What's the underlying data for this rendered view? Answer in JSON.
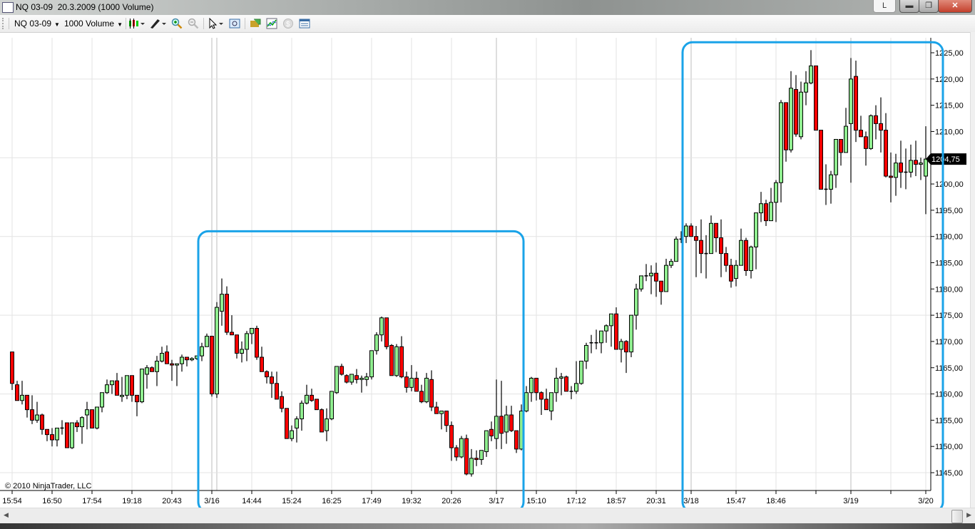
{
  "window": {
    "title": "NQ 03-09  20.3.2009 (1000 Volume)",
    "layout_button": "L",
    "minimize_icon": "minimize-icon",
    "maximize_icon": "restore-icon",
    "close_icon": "close-icon"
  },
  "toolbar": {
    "instrument": "NQ 03-09",
    "period": "1000 Volume",
    "icons": [
      "candlestick-style-icon",
      "drawing-pencil-icon",
      "zoom-in-icon",
      "zoom-out-icon",
      "pointer-icon",
      "data-box-icon",
      "strategies-icon",
      "indicators-icon",
      "currency-icon",
      "properties-icon"
    ]
  },
  "colors": {
    "up_candle": "#90ee90",
    "down_candle": "#ff0000",
    "highlight_box": "#1aa3e8",
    "grid": "#e3e3e3",
    "session_line": "#bdbdbd"
  },
  "chart": {
    "copyright": "© 2010 NinjaTrader, LLC",
    "last_price_label": "1204,75"
  },
  "chart_data": {
    "type": "candlestick",
    "instrument": "NQ 03-09",
    "bar_type": "1000 Volume",
    "ylim": [
      1143,
      1228
    ],
    "y_ticks": [
      "1225,00",
      "1220,00",
      "1215,00",
      "1210,00",
      "1205,00",
      "1200,00",
      "1195,00",
      "1190,00",
      "1185,00",
      "1180,00",
      "1175,00",
      "1170,00",
      "1165,00",
      "1160,00",
      "1155,00",
      "1150,00",
      "1145,00"
    ],
    "y_tick_values": [
      1225,
      1220,
      1215,
      1210,
      1205,
      1200,
      1195,
      1190,
      1185,
      1180,
      1175,
      1170,
      1165,
      1160,
      1155,
      1150,
      1145
    ],
    "x_ticks": [
      {
        "label": "15:54",
        "bar": 0
      },
      {
        "label": "16:50",
        "bar": 8
      },
      {
        "label": "17:54",
        "bar": 16
      },
      {
        "label": "19:18",
        "bar": 24
      },
      {
        "label": "20:43",
        "bar": 32
      },
      {
        "label": "3/16",
        "bar": 40
      },
      {
        "label": "14:44",
        "bar": 48
      },
      {
        "label": "15:24",
        "bar": 56
      },
      {
        "label": "16:25",
        "bar": 64
      },
      {
        "label": "17:49",
        "bar": 72
      },
      {
        "label": "19:32",
        "bar": 80
      },
      {
        "label": "20:26",
        "bar": 88
      },
      {
        "label": "3/17",
        "bar": 97
      },
      {
        "label": "15:10",
        "bar": 105
      },
      {
        "label": "17:12",
        "bar": 113
      },
      {
        "label": "18:57",
        "bar": 121
      },
      {
        "label": "20:31",
        "bar": 129
      },
      {
        "label": "3/18",
        "bar": 136
      },
      {
        "label": "15:47",
        "bar": 145
      },
      {
        "label": "18:46",
        "bar": 153
      },
      {
        "label": "",
        "bar": 161
      },
      {
        "label": "3/19",
        "bar": 168
      },
      {
        "label": "",
        "bar": 176
      },
      {
        "label": "3/20",
        "bar": 183
      }
    ],
    "session_breaks": [
      40,
      97,
      136,
      168
    ],
    "last_price": 1204.75,
    "ohlc": [
      [
        1168,
        1168,
        1160.75,
        1162
      ],
      [
        1161.75,
        1162.5,
        1158.75,
        1158.75
      ],
      [
        1158.75,
        1162.5,
        1158,
        1159.75
      ],
      [
        1159.75,
        1159.75,
        1155.5,
        1157
      ],
      [
        1157,
        1159.75,
        1154.25,
        1155
      ],
      [
        1155,
        1158.5,
        1154.5,
        1156
      ],
      [
        1156,
        1156.25,
        1152.25,
        1153.25
      ],
      [
        1153.25,
        1153.25,
        1151,
        1152.25
      ],
      [
        1152.25,
        1153.5,
        1150,
        1151.25
      ],
      [
        1151.25,
        1153.5,
        1150,
        1153.5
      ],
      [
        1153.5,
        1155,
        1152.25,
        1153.5
      ],
      [
        1154.5,
        1154.5,
        1149.75,
        1149.75
      ],
      [
        1149.75,
        1154.5,
        1149.5,
        1154.5
      ],
      [
        1154.5,
        1155,
        1152.75,
        1153.75
      ],
      [
        1153.75,
        1155.75,
        1150.5,
        1155.5
      ],
      [
        1156,
        1158.5,
        1153.25,
        1157
      ],
      [
        1157,
        1157,
        1153.5,
        1153.5
      ],
      [
        1153.5,
        1157.5,
        1153.25,
        1157.5
      ],
      [
        1157.5,
        1160.25,
        1156.5,
        1160.25
      ],
      [
        1160.25,
        1162.75,
        1160,
        1161.75
      ],
      [
        1161.75,
        1162.5,
        1160,
        1162.5
      ],
      [
        1162.5,
        1164,
        1159.75,
        1159.75
      ],
      [
        1159.5,
        1163.25,
        1158.5,
        1159.75
      ],
      [
        1159.75,
        1163.5,
        1159,
        1163.5
      ],
      [
        1163.5,
        1163.5,
        1158.5,
        1159.75
      ],
      [
        1159.75,
        1159.75,
        1155.75,
        1158.5
      ],
      [
        1158.5,
        1164.75,
        1158.25,
        1164.75
      ],
      [
        1163.75,
        1165.5,
        1161,
        1165
      ],
      [
        1165,
        1165.25,
        1164.25,
        1164.25
      ],
      [
        1164.25,
        1167.25,
        1161.5,
        1166.25
      ],
      [
        1166.25,
        1169,
        1166,
        1167.75
      ],
      [
        1168,
        1169.25,
        1165.75,
        1165.75
      ],
      [
        1165.75,
        1166.5,
        1162.5,
        1165.5
      ],
      [
        1165.5,
        1165.75,
        1161.5,
        1165.75
      ],
      [
        1165.75,
        1167.5,
        1164.25,
        1167
      ],
      [
        1167,
        1167,
        1165.25,
        1166.5
      ],
      [
        1166.5,
        1167,
        1166.25,
        1166.75
      ],
      [
        1166.75,
        1167.25,
        1166.5,
        1167.25
      ],
      [
        1167.25,
        1169.75,
        1166.25,
        1169
      ],
      [
        1169,
        1171.5,
        1169,
        1171
      ],
      [
        1171,
        1171,
        1159.5,
        1160
      ],
      [
        1160,
        1177.5,
        1159.25,
        1176.5
      ],
      [
        1175.75,
        1182,
        1173,
        1179
      ],
      [
        1179,
        1180.5,
        1171.25,
        1171.75
      ],
      [
        1171.75,
        1175,
        1171.25,
        1171.25
      ],
      [
        1171.25,
        1171.25,
        1166.75,
        1167.75
      ],
      [
        1167.75,
        1170,
        1166,
        1168.5
      ],
      [
        1168.5,
        1172,
        1166.25,
        1171.5
      ],
      [
        1171.5,
        1172.5,
        1169.5,
        1172.5
      ],
      [
        1172.5,
        1173,
        1166.5,
        1167
      ],
      [
        1167,
        1169,
        1164.25,
        1164.25
      ],
      [
        1164.25,
        1164.5,
        1162,
        1163.25
      ],
      [
        1163.25,
        1164.25,
        1159.25,
        1162
      ],
      [
        1162,
        1164.25,
        1159,
        1159
      ],
      [
        1159.5,
        1160.5,
        1156.5,
        1157.25
      ],
      [
        1157.25,
        1157.25,
        1151.5,
        1151.5
      ],
      [
        1151.5,
        1154,
        1151,
        1153
      ],
      [
        1153.5,
        1155.75,
        1150.75,
        1155.25
      ],
      [
        1155.25,
        1158.75,
        1153,
        1158.25
      ],
      [
        1158.25,
        1161.75,
        1158,
        1159.75
      ],
      [
        1159.75,
        1161,
        1158.5,
        1158.75
      ],
      [
        1159,
        1159,
        1157,
        1157
      ],
      [
        1157,
        1157.25,
        1152.75,
        1152.75
      ],
      [
        1153,
        1157.25,
        1151,
        1155.25
      ],
      [
        1155.25,
        1160.5,
        1155,
        1160.5
      ],
      [
        1160.25,
        1165.25,
        1160,
        1165.25
      ],
      [
        1165.25,
        1165.75,
        1163.5,
        1163.75
      ],
      [
        1163.5,
        1163.75,
        1162,
        1162.25
      ],
      [
        1162.25,
        1163.75,
        1161.75,
        1163.75
      ],
      [
        1163.5,
        1164.75,
        1162,
        1162.75
      ],
      [
        1162.75,
        1163.5,
        1160.25,
        1163
      ],
      [
        1162.75,
        1164,
        1161.5,
        1163.25
      ],
      [
        1163.25,
        1168.25,
        1162.75,
        1168.25
      ],
      [
        1168.25,
        1171.75,
        1167.5,
        1171.25
      ],
      [
        1171.25,
        1174.75,
        1170,
        1174.5
      ],
      [
        1174.5,
        1174.5,
        1168.5,
        1169
      ],
      [
        1169.25,
        1169.5,
        1163.5,
        1163.5
      ],
      [
        1163.5,
        1169.5,
        1163.25,
        1169
      ],
      [
        1169,
        1171,
        1163,
        1163.25
      ],
      [
        1163.25,
        1164.25,
        1160.25,
        1161.25
      ],
      [
        1161.25,
        1165.5,
        1160.5,
        1163
      ],
      [
        1163,
        1164.25,
        1160.5,
        1160.5
      ],
      [
        1160.5,
        1161.75,
        1158.25,
        1158.5
      ],
      [
        1158.5,
        1164,
        1158.25,
        1163
      ],
      [
        1162.75,
        1164.5,
        1156.75,
        1157.5
      ],
      [
        1157.5,
        1158.5,
        1156.25,
        1156.25
      ],
      [
        1156.25,
        1156.75,
        1153.25,
        1156.75
      ],
      [
        1156.75,
        1156.75,
        1152.75,
        1154
      ],
      [
        1154,
        1154.75,
        1147.25,
        1149.75
      ],
      [
        1149.75,
        1150.25,
        1147.25,
        1148
      ],
      [
        1148,
        1152,
        1147.75,
        1151.5
      ],
      [
        1151.5,
        1152.25,
        1144.5,
        1144.75
      ],
      [
        1144.75,
        1149.5,
        1144.25,
        1147.75
      ],
      [
        1147.75,
        1149.25,
        1146.25,
        1147.5
      ],
      [
        1147.5,
        1149.25,
        1146.5,
        1149.25
      ],
      [
        1149,
        1153,
        1148,
        1153
      ],
      [
        1153.25,
        1154.75,
        1151,
        1152
      ],
      [
        1151.5,
        1162.75,
        1149.5,
        1155.75
      ],
      [
        1155.75,
        1162.5,
        1149.5,
        1152.5
      ],
      [
        1152.75,
        1157.75,
        1150.5,
        1156
      ],
      [
        1156,
        1157.75,
        1152.75,
        1153
      ],
      [
        1153,
        1153,
        1148.75,
        1149.5
      ],
      [
        1149.5,
        1158,
        1149.25,
        1156.75
      ],
      [
        1156.75,
        1161.5,
        1156.5,
        1160.25
      ],
      [
        1160.25,
        1163.25,
        1158.5,
        1163
      ],
      [
        1163,
        1163,
        1158.75,
        1160.25
      ],
      [
        1160.25,
        1160.5,
        1156,
        1159
      ],
      [
        1159,
        1161,
        1157,
        1157
      ],
      [
        1156.75,
        1160.25,
        1155,
        1160.25
      ],
      [
        1160.25,
        1165,
        1158.5,
        1163
      ],
      [
        1163,
        1164,
        1159.75,
        1163.25
      ],
      [
        1163.25,
        1163.5,
        1160.5,
        1160.5
      ],
      [
        1160.5,
        1161.5,
        1159,
        1160.5
      ],
      [
        1160.5,
        1166.25,
        1160,
        1162
      ],
      [
        1162,
        1166.25,
        1161.75,
        1166.25
      ],
      [
        1166.25,
        1169.75,
        1164.75,
        1169.25
      ],
      [
        1169.75,
        1171.25,
        1167.75,
        1169.75
      ],
      [
        1169.75,
        1172.25,
        1168.5,
        1169.75
      ],
      [
        1169.75,
        1172,
        1167.75,
        1172
      ],
      [
        1172,
        1173.25,
        1169.75,
        1173
      ],
      [
        1173,
        1175.25,
        1169,
        1175.25
      ],
      [
        1175.25,
        1176.5,
        1168.5,
        1168.5
      ],
      [
        1168.5,
        1170.5,
        1166,
        1170
      ],
      [
        1170,
        1170.25,
        1164,
        1168
      ],
      [
        1168,
        1175,
        1167,
        1175
      ],
      [
        1175,
        1181,
        1172.25,
        1180
      ],
      [
        1180,
        1182.5,
        1179.5,
        1182.5
      ],
      [
        1182.5,
        1184.75,
        1181.5,
        1182.5
      ],
      [
        1182.5,
        1184.5,
        1179,
        1183
      ],
      [
        1183,
        1185,
        1178.5,
        1181.5
      ],
      [
        1181.5,
        1181.5,
        1177,
        1179.5
      ],
      [
        1179.5,
        1185.75,
        1179.5,
        1184.5
      ],
      [
        1184.5,
        1185.75,
        1184,
        1185.25
      ],
      [
        1185.25,
        1190,
        1185.25,
        1189.5
      ],
      [
        1189.5,
        1191,
        1188.75,
        1189.5
      ],
      [
        1190,
        1192.5,
        1188.75,
        1192
      ],
      [
        1192,
        1192.5,
        1190,
        1190
      ],
      [
        1190,
        1192,
        1182.25,
        1189.25
      ],
      [
        1189.25,
        1193.25,
        1183,
        1186.75
      ],
      [
        1186.75,
        1190.25,
        1182,
        1186.75
      ],
      [
        1186.75,
        1194,
        1186.75,
        1192.5
      ],
      [
        1192.5,
        1192.5,
        1187,
        1189.75
      ],
      [
        1189.75,
        1193.25,
        1182.25,
        1186.75
      ],
      [
        1186.75,
        1188,
        1183.25,
        1184.5
      ],
      [
        1184.5,
        1185.75,
        1180.25,
        1181.5
      ],
      [
        1182,
        1185.5,
        1180.5,
        1184.5
      ],
      [
        1184.5,
        1191.5,
        1184.5,
        1189.25
      ],
      [
        1189.25,
        1189.75,
        1182.5,
        1183.5
      ],
      [
        1183.5,
        1188.25,
        1182,
        1188
      ],
      [
        1188,
        1194.5,
        1183.75,
        1194.5
      ],
      [
        1194.5,
        1198.5,
        1192.75,
        1196.25
      ],
      [
        1196.25,
        1197,
        1192,
        1193
      ],
      [
        1193,
        1199.25,
        1193,
        1196.5
      ],
      [
        1196.5,
        1200.75,
        1192.75,
        1200.25
      ],
      [
        1200.25,
        1216,
        1196.5,
        1215.5
      ],
      [
        1215.5,
        1215.5,
        1204.25,
        1206.5
      ],
      [
        1206.5,
        1221.5,
        1206,
        1218.25
      ],
      [
        1218,
        1220.75,
        1209,
        1209.5
      ],
      [
        1209,
        1219.5,
        1208.5,
        1217.5
      ],
      [
        1217.5,
        1221.5,
        1215,
        1219.25
      ],
      [
        1219.25,
        1225.5,
        1219,
        1222.5
      ],
      [
        1222.5,
        1222.5,
        1210.25,
        1210.25
      ],
      [
        1210.25,
        1210.25,
        1199,
        1199
      ],
      [
        1199,
        1203.75,
        1196,
        1199
      ],
      [
        1199,
        1202.5,
        1196.25,
        1201.75
      ],
      [
        1201.75,
        1208.5,
        1199.25,
        1208.5
      ],
      [
        1208.5,
        1208.5,
        1203.5,
        1206
      ],
      [
        1206,
        1214.5,
        1206,
        1211
      ],
      [
        1211.5,
        1224,
        1200.25,
        1220
      ],
      [
        1220.5,
        1223.5,
        1208,
        1210.25
      ],
      [
        1210.25,
        1213,
        1209,
        1209
      ],
      [
        1209,
        1210,
        1203.5,
        1206.75
      ],
      [
        1206.75,
        1213.25,
        1206.5,
        1213
      ],
      [
        1213,
        1215,
        1208.5,
        1211.5
      ],
      [
        1211.5,
        1216.5,
        1206,
        1210.25
      ],
      [
        1210.25,
        1213.5,
        1201.25,
        1201.5
      ],
      [
        1201.5,
        1206,
        1196.5,
        1201.25
      ],
      [
        1201.25,
        1205.75,
        1197.75,
        1204
      ],
      [
        1204,
        1208.25,
        1199.25,
        1202.25
      ],
      [
        1202.25,
        1206.75,
        1199,
        1202.25
      ],
      [
        1202.25,
        1207.5,
        1201.25,
        1204.5
      ],
      [
        1204.5,
        1208.25,
        1201.5,
        1203.75
      ],
      [
        1203.75,
        1205,
        1200.75,
        1204
      ],
      [
        1201.5,
        1211,
        1194.25,
        1204.75
      ]
    ],
    "highlight_ranges": [
      {
        "from_bar": 38,
        "to_bar": 101,
        "price_low": 1142,
        "price_high": 1191
      },
      {
        "from_bar": 135,
        "to_bar": 185,
        "price_low": 1143,
        "price_high": 1227
      }
    ]
  }
}
